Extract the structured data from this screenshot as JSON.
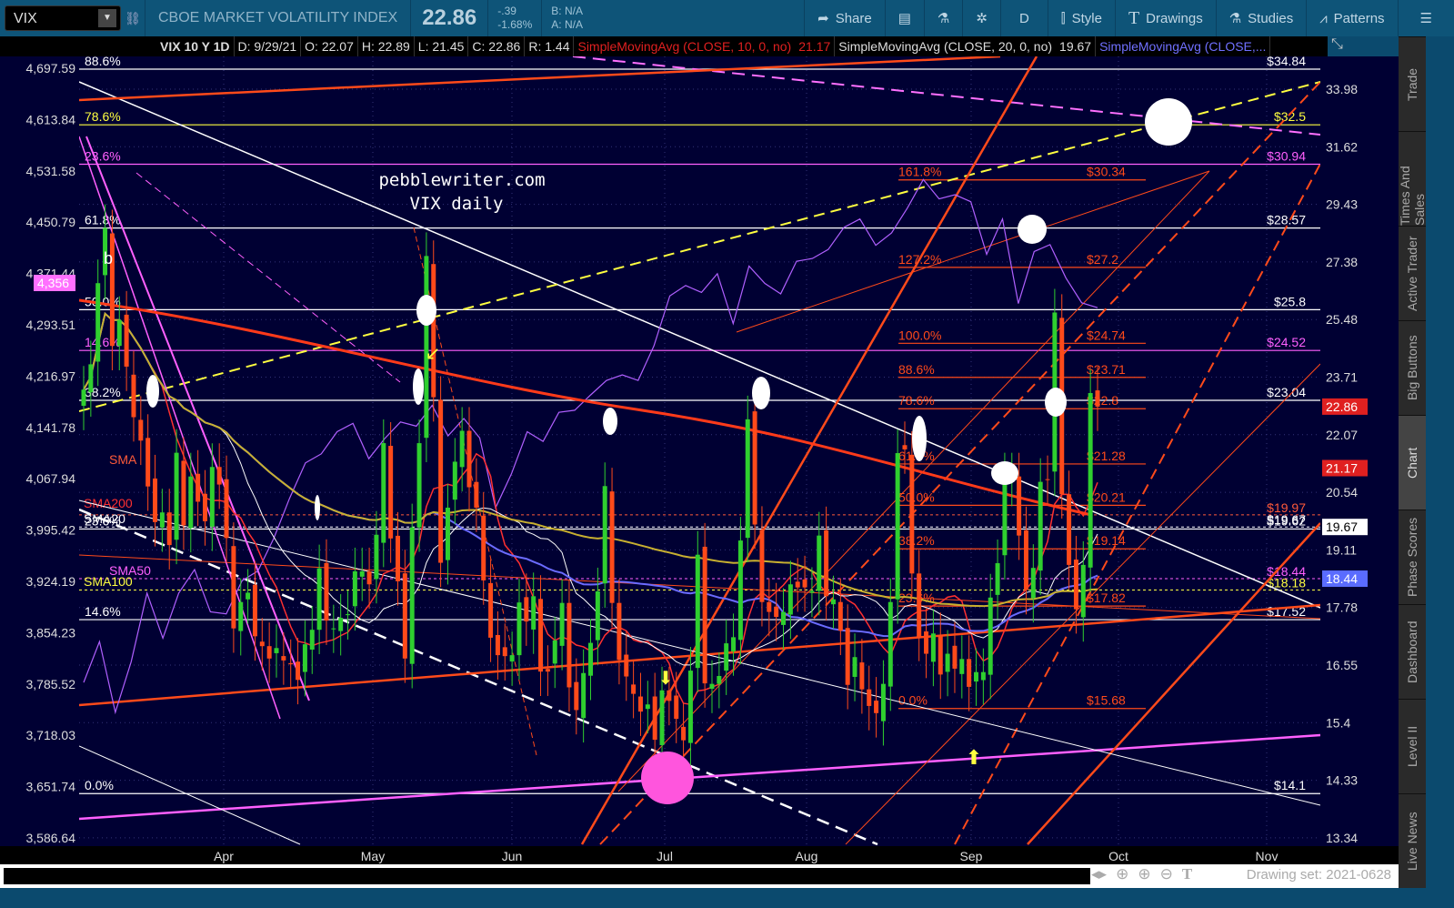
{
  "toolbar": {
    "symbol": "VIX",
    "name": "CBOE MARKET VOLATILITY INDEX",
    "last": "22.86",
    "change": "-.39",
    "change_pct": "-1.68%",
    "bid": "B: N/A",
    "ask": "A: N/A",
    "buttons": [
      {
        "icon": "share-icon",
        "label": "Share"
      },
      {
        "icon": "info-icon",
        "label": ""
      },
      {
        "icon": "flask-icon",
        "label": ""
      },
      {
        "icon": "gear-icon",
        "label": ""
      },
      {
        "icon": "",
        "label": "D"
      },
      {
        "icon": "candle-icon",
        "label": "Style"
      },
      {
        "icon": "text-icon",
        "label": "Drawings"
      },
      {
        "icon": "flask-icon",
        "label": "Studies"
      },
      {
        "icon": "pattern-icon",
        "label": "Patterns"
      },
      {
        "icon": "menu-icon",
        "label": ""
      }
    ]
  },
  "header": {
    "title": "VIX 10 Y 1D",
    "date": "D: 9/29/21",
    "open": "O: 22.07",
    "high": "H: 22.89",
    "low": "L: 21.45",
    "close": "C: 22.86",
    "range": "R: 1.44",
    "studies": [
      {
        "label": "SimpleMovingAvg (CLOSE, 10, 0, no)",
        "value": "21.17",
        "color": "#e02020"
      },
      {
        "label": "SimpleMovingAvg (CLOSE, 20, 0, no)",
        "value": "19.67",
        "color": "#ffffff"
      },
      {
        "label": "SimpleMovingAvg (CLOSE,...",
        "value": "",
        "color": "#7070ff"
      }
    ]
  },
  "side_tabs": [
    "Trade",
    "Times And Sales",
    "Active Trader",
    "Big Buttons",
    "Chart",
    "Phase Scores",
    "Dashboard",
    "Level II",
    "Live News"
  ],
  "bottom": {
    "drawing_set": "Drawing set: 2021-0628"
  },
  "chart_data": {
    "type": "candlestick",
    "title": "pebblewriter.com",
    "subtitle": "VIX daily",
    "y_right_ticks": [
      "33.98",
      "31.62",
      "29.43",
      "27.38",
      "25.48",
      "23.71",
      "22.07",
      "20.54",
      "19.11",
      "17.78",
      "16.55",
      "15.4",
      "14.33",
      "13.34"
    ],
    "y_right_range": [
      13.34,
      33.98
    ],
    "y_scale": "log",
    "y_left_ticks": [
      "4,697.59",
      "4,613.84",
      "4,531.58",
      "4,450.79",
      "4,371.44",
      "4,293.51",
      "4,216.97",
      "4,141.78",
      "4,067.94",
      "3,995.42",
      "3,924.19",
      "3,854.23",
      "3,785.52",
      "3,718.03",
      "3,651.74",
      "3,586.64"
    ],
    "x_ticks": [
      "Apr",
      "May",
      "Jun",
      "Jul",
      "Aug",
      "Sep",
      "Oct",
      "Nov"
    ],
    "closes": [
      23.35,
      24.1,
      26.67,
      28.57,
      24.66,
      25.47,
      24.03,
      22.56,
      21.91,
      20.69,
      19.79,
      20.03,
      19.23,
      21.58,
      19.71,
      20.95,
      20.3,
      19.81,
      21.2,
      20.74,
      19.4,
      17.33,
      17.91,
      18.12,
      17.16,
      16.95,
      16.69,
      16.91,
      16.65,
      16.57,
      16.25,
      16.99,
      17.3,
      18.68,
      17.5,
      17.33,
      17.56,
      17.64,
      18.61,
      18.61,
      18.31,
      19.48,
      21.84,
      19.39,
      18.38,
      16.69,
      19.66,
      21.84,
      27.59,
      23.13,
      18.81,
      20.15,
      21.34,
      22.18,
      20.67,
      20.15,
      18.4,
      17.13,
      16.76,
      16.74,
      16.76,
      17.9,
      17.48,
      18.04,
      16.42,
      16.42,
      17.07,
      17.89,
      16.1,
      15.65,
      16.39,
      17.02,
      18.15,
      20.7,
      17.89,
      16.66,
      16.32,
      15.97,
      15.62,
      15.76,
      15.08,
      16.04,
      15.83,
      15.48,
      15.07,
      16.44,
      19.0,
      16.18,
      16.17,
      16.33,
      17.01,
      17.14,
      19.34,
      22.5,
      19.73,
      17.91,
      17.69,
      17.58,
      17.69,
      18.31,
      18.24,
      18.24,
      18.16,
      19.46,
      18.04,
      17.97,
      17.28,
      16.15,
      16.72,
      16.06,
      15.73,
      15.59,
      16.17,
      17.91,
      21.57,
      21.67,
      18.56,
      17.15,
      16.79,
      17.22,
      16.36,
      16.79,
      16.48,
      16.68,
      16.11,
      16.41,
      16.41,
      18.01,
      18.8,
      20.95,
      20.95,
      19.46,
      18.18,
      18.69,
      20.81,
      20.87,
      25.71,
      20.49,
      18.76,
      17.75,
      18.76,
      23.25,
      22.86
    ],
    "fib_left": [
      {
        "label": "88.6%",
        "price": 34.84,
        "tag": "$34.84",
        "color": "#ffffff"
      },
      {
        "label": "78.6%",
        "price": 32.5,
        "tag": "$32.5",
        "color": "#ffff40"
      },
      {
        "label": "23.6%",
        "price": 30.94,
        "tag": "$30.94",
        "color": "#ff60ff"
      },
      {
        "label": "61.8%",
        "price": 28.57,
        "tag": "$28.57",
        "color": "#ffffff"
      },
      {
        "label": "50.0%",
        "price": 25.8,
        "tag": "$25.8",
        "color": "#ffffff"
      },
      {
        "label": "14.6%",
        "price": 24.52,
        "tag": "$24.52",
        "color": "#ff60ff"
      },
      {
        "label": "38.2%",
        "price": 23.04,
        "tag": "$23.04",
        "color": "#ffffff"
      },
      {
        "label": "23.6%",
        "price": 19.62,
        "tag": "$19.62",
        "color": "#ffffff"
      },
      {
        "label": "14.6%",
        "price": 17.52,
        "tag": "$17.52",
        "color": "#ffffff"
      },
      {
        "label": "0.0%",
        "price": 14.1,
        "tag": "$14.1",
        "color": "#ffffff"
      }
    ],
    "fib_mid": [
      {
        "label": "161.8%",
        "tag": "$30.34",
        "price": 30.34
      },
      {
        "label": "127.2%",
        "tag": "$27.2",
        "price": 27.2
      },
      {
        "label": "100.0%",
        "tag": "$24.74",
        "price": 24.74
      },
      {
        "label": "88.6%",
        "tag": "$23.71",
        "price": 23.71
      },
      {
        "label": "78.6%",
        "tag": "$22.8",
        "price": 22.8
      },
      {
        "label": "61.8%",
        "tag": "$21.28",
        "price": 21.28
      },
      {
        "label": "50.0%",
        "tag": "$20.21",
        "price": 20.21
      },
      {
        "label": "38.2%",
        "tag": "$19.14",
        "price": 19.14
      },
      {
        "label": "23.6%",
        "tag": "$17.82",
        "price": 17.82
      },
      {
        "label": "0.0%",
        "tag": "$15.68",
        "price": 15.68
      }
    ],
    "sma_tags": [
      {
        "label": "$19.97",
        "price": 19.97,
        "color": "#ff5a3a"
      },
      {
        "label": "$19.67",
        "price": 19.67,
        "color": "#ffffff"
      },
      {
        "label": "$18.44",
        "price": 18.44,
        "color": "#ff60ff"
      },
      {
        "label": "$18.18",
        "price": 18.18,
        "color": "#ffff40"
      }
    ],
    "sma_labels": [
      {
        "label": "SMA",
        "color": "#ff5a3a"
      },
      {
        "label": "SMA200",
        "color": "#ff3030"
      },
      {
        "label": "SMA20",
        "color": "#ffffff"
      },
      {
        "label": "SMA50",
        "color": "#ff60ff"
      },
      {
        "label": "SMA100",
        "color": "#ffff40"
      }
    ],
    "price_boxes": [
      {
        "label": "22.86",
        "price": 22.86,
        "color": "#e02020"
      },
      {
        "label": "21.17",
        "price": 21.17,
        "color": "#e02020"
      },
      {
        "label": "19.67",
        "price": 19.67,
        "color": "#ffffff"
      },
      {
        "label": "18.44",
        "price": 18.44,
        "color": "#5a6cff"
      }
    ],
    "left_box": "4,356",
    "wave_label": "b",
    "spx_overlay": [
      3811,
      3870,
      3768,
      3841,
      3940,
      3875,
      3940,
      3974,
      3913,
      3910,
      3958,
      3972,
      4019,
      4077,
      4128,
      4141,
      4173,
      4185,
      4134,
      4163,
      4187,
      4181,
      4211,
      4167,
      4192,
      4164,
      4063,
      4112,
      4173,
      4159,
      4201,
      4204,
      4226,
      4247,
      4255,
      4247,
      4297,
      4369,
      4384,
      4374,
      4401,
      4329,
      4412,
      4387,
      4372,
      4419,
      4423,
      4436,
      4468,
      4480,
      4442,
      4460,
      4496,
      4537,
      4509,
      4515,
      4505,
      4429,
      4480,
      4358,
      4433,
      4443,
      4395,
      4359,
      4352
    ]
  }
}
